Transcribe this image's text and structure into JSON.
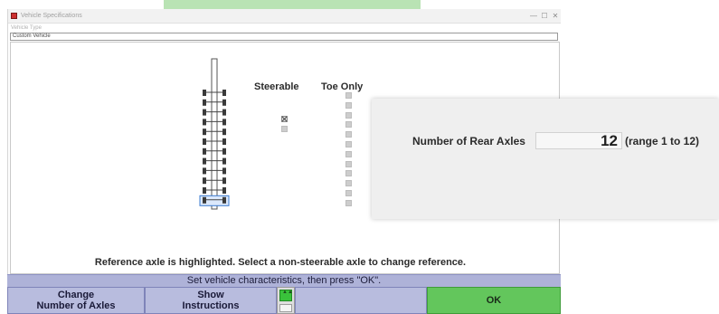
{
  "window": {
    "title": "Vehicle Specifications",
    "controls": {
      "minimize": "—",
      "maximize": "☐",
      "close": "✕"
    }
  },
  "vehicle_type": {
    "caption": "Vehicle Type",
    "value": "Custom Vehicle"
  },
  "columns": {
    "steerable": "Steerable",
    "toe_only": "Toe Only"
  },
  "axles": {
    "count": 12,
    "reference_axle": 12,
    "steerable": [
      true,
      false,
      false,
      false,
      false,
      false,
      false,
      false,
      false,
      false,
      false,
      false
    ],
    "toe_only": [
      false,
      false,
      false,
      false,
      false,
      false,
      false,
      false,
      false,
      false,
      false,
      false
    ],
    "checkbox_colors": {
      "normal": "#cdcdcd",
      "checked_mark": "#444444"
    },
    "highlight_color": "#3b7bd0"
  },
  "reference_note": "Reference axle is highlighted.  Select a non-steerable axle to change reference.",
  "status": "Set vehicle characteristics, then press \"OK\".",
  "function_keys": {
    "f1_line1": "Change",
    "f1_line2": "Number of Axles",
    "f2_line1": "Show",
    "f2_line2": "Instructions",
    "blank": "",
    "ok": "OK"
  },
  "popup": {
    "label": "Number of Rear Axles",
    "value": "12",
    "range": "(range 1 to 12)"
  },
  "colors": {
    "ok_green": "#63c65c",
    "bar_lavender": "#aeb2d8",
    "key_lavender": "#b8bcde"
  }
}
